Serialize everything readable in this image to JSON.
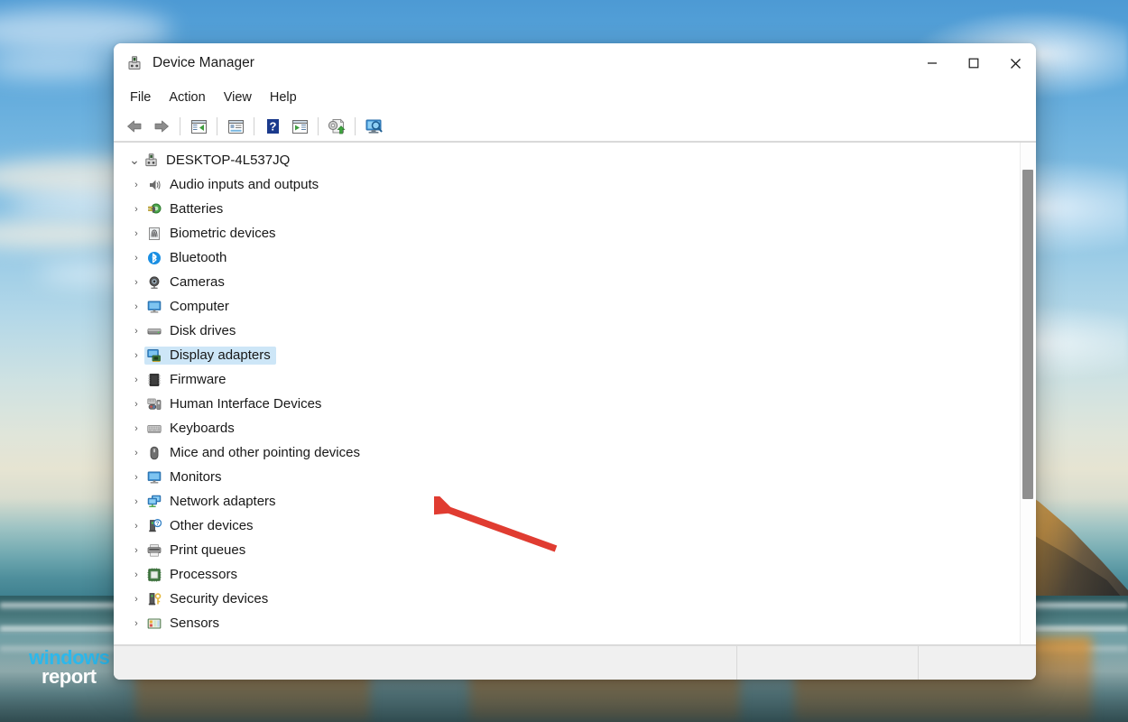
{
  "window": {
    "title": "Device Manager",
    "app_icon": "device-manager-icon",
    "controls": {
      "minimize": "—",
      "maximize": "□",
      "close": "✕"
    }
  },
  "menubar": {
    "items": [
      {
        "label": "File",
        "name": "menu-file"
      },
      {
        "label": "Action",
        "name": "menu-action"
      },
      {
        "label": "View",
        "name": "menu-view"
      },
      {
        "label": "Help",
        "name": "menu-help"
      }
    ]
  },
  "toolbar": {
    "buttons": [
      {
        "name": "back-button",
        "icon": "back-arrow-icon"
      },
      {
        "name": "forward-button",
        "icon": "forward-arrow-icon"
      },
      {
        "name": "show-hide-console-tree-button",
        "icon": "console-tree-icon"
      },
      {
        "name": "properties-button",
        "icon": "properties-icon"
      },
      {
        "name": "help-button",
        "icon": "help-question-icon"
      },
      {
        "name": "scan-for-hardware-changes-button",
        "icon": "scan-hardware-icon"
      },
      {
        "name": "update-driver-button",
        "icon": "update-driver-icon"
      },
      {
        "name": "show-all-devices-button",
        "icon": "monitor-search-icon"
      }
    ]
  },
  "tree": {
    "root": {
      "label": "DESKTOP-4L537JQ",
      "icon": "computer-device-icon",
      "expanded": true,
      "twisty": "⌄"
    },
    "twisty_collapsed": "›",
    "items": [
      {
        "label": "Audio inputs and outputs",
        "icon": "speaker-icon",
        "selected": false
      },
      {
        "label": "Batteries",
        "icon": "battery-plug-icon",
        "selected": false
      },
      {
        "label": "Biometric devices",
        "icon": "fingerprint-icon",
        "selected": false
      },
      {
        "label": "Bluetooth",
        "icon": "bluetooth-icon",
        "selected": false
      },
      {
        "label": "Cameras",
        "icon": "webcam-icon",
        "selected": false
      },
      {
        "label": "Computer",
        "icon": "monitor-icon",
        "selected": false
      },
      {
        "label": "Disk drives",
        "icon": "disk-drive-icon",
        "selected": false
      },
      {
        "label": "Display adapters",
        "icon": "display-adapter-icon",
        "selected": true
      },
      {
        "label": "Firmware",
        "icon": "firmware-chip-icon",
        "selected": false
      },
      {
        "label": "Human Interface Devices",
        "icon": "gamepad-icon",
        "selected": false
      },
      {
        "label": "Keyboards",
        "icon": "keyboard-icon",
        "selected": false
      },
      {
        "label": "Mice and other pointing devices",
        "icon": "mouse-icon",
        "selected": false
      },
      {
        "label": "Monitors",
        "icon": "monitor-icon",
        "selected": false
      },
      {
        "label": "Network adapters",
        "icon": "network-adapter-icon",
        "selected": false
      },
      {
        "label": "Other devices",
        "icon": "unknown-device-icon",
        "selected": false
      },
      {
        "label": "Print queues",
        "icon": "printer-icon",
        "selected": false
      },
      {
        "label": "Processors",
        "icon": "processor-icon",
        "selected": false
      },
      {
        "label": "Security devices",
        "icon": "security-key-icon",
        "selected": false
      },
      {
        "label": "Sensors",
        "icon": "sensors-icon",
        "selected": false
      }
    ]
  },
  "scrollbar": {
    "name": "vertical-scrollbar",
    "thumb_top_pct": 5,
    "thumb_height_pct": 67
  },
  "statusbar": {
    "cells": [
      "",
      "",
      ""
    ]
  },
  "annotation": {
    "arrow_color": "#E03C31",
    "points_to": "Display adapters"
  },
  "watermark": {
    "line1": "windows",
    "line2": "report",
    "color1": "#2CB8EC",
    "color2": "#FFFFFF"
  },
  "colors": {
    "selection": "#CDE6F7",
    "window_bg": "#FFFFFF",
    "statusbar_bg": "#F0F0F0",
    "accent_red": "#E03C31"
  }
}
